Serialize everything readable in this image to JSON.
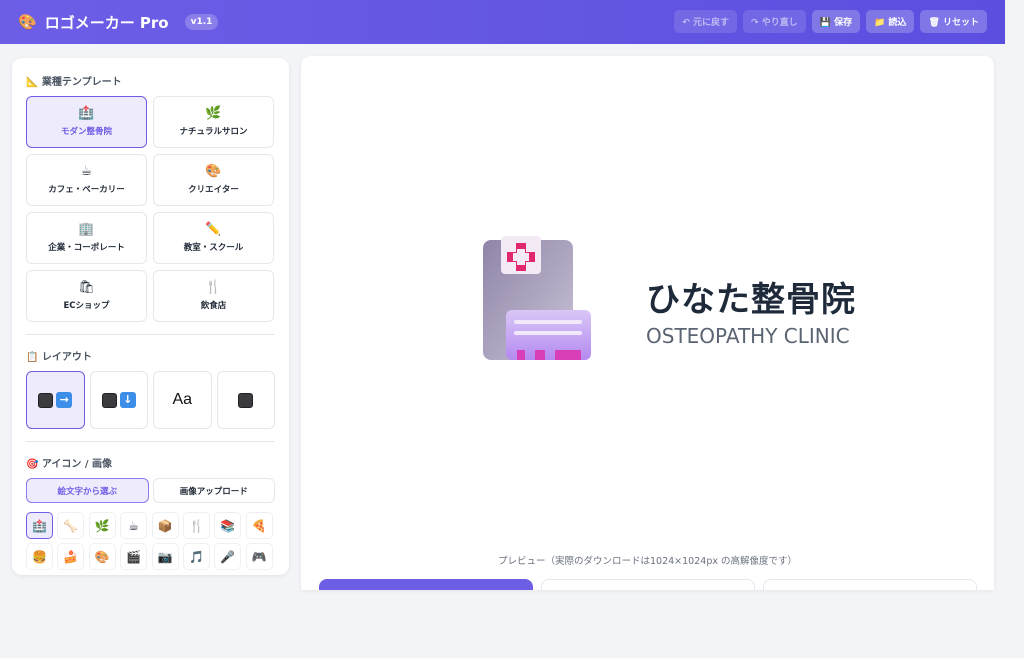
{
  "header": {
    "logo_icon": "palette-icon",
    "title": "ロゴメーカー Pro",
    "version": "v1.1",
    "buttons": {
      "undo": "↶ 元に戻す",
      "redo": "↷ やり直し",
      "save": "💾 保存",
      "load": "📁 読込",
      "reset": "🗑 リセット"
    }
  },
  "sidebar": {
    "templates": {
      "title": "📐 業種テンプレート",
      "items": [
        {
          "icon": "🏥",
          "label": "モダン整骨院",
          "selected": true
        },
        {
          "icon": "🌿",
          "label": "ナチュラルサロン",
          "selected": false
        },
        {
          "icon": "☕",
          "label": "カフェ・ベーカリー",
          "selected": false
        },
        {
          "icon": "🎨",
          "label": "クリエイター",
          "selected": false
        },
        {
          "icon": "🏢",
          "label": "企業・コーポレート",
          "selected": false
        },
        {
          "icon": "✏️",
          "label": "教室・スクール",
          "selected": false
        },
        {
          "icon": "🛍",
          "label": "ECショップ",
          "selected": false
        },
        {
          "icon": "🍴",
          "label": "飲食店",
          "selected": false
        }
      ]
    },
    "layout": {
      "title": "📋 レイアウト",
      "options": [
        "horizontal",
        "vertical",
        "text-only",
        "icon-only"
      ],
      "text_option": "Aa",
      "selected": "horizontal"
    },
    "icon_section": {
      "title": "🎯 アイコン / 画像",
      "tabs": [
        "絵文字から選ぶ",
        "画像アップロード"
      ],
      "emojis": [
        "🏥",
        "🦴",
        "🌿",
        "☕",
        "📦",
        "🍴",
        "📚",
        "🍕",
        "🍔",
        "🍰",
        "🎨",
        "🎬",
        "📷",
        "🎵",
        "🎤",
        "🎮"
      ]
    }
  },
  "preview": {
    "brand_name": "ひなた整骨院",
    "brand_sub": "OSTEOPATHY CLINIC",
    "note": "プレビュー（実際のダウンロードは1024×1024px の高解像度です）"
  },
  "colors": {
    "accent": "#6d5ee6",
    "text_dark": "#1e2a3a",
    "text_sub": "#5a6472",
    "cross": "#e0276f"
  }
}
